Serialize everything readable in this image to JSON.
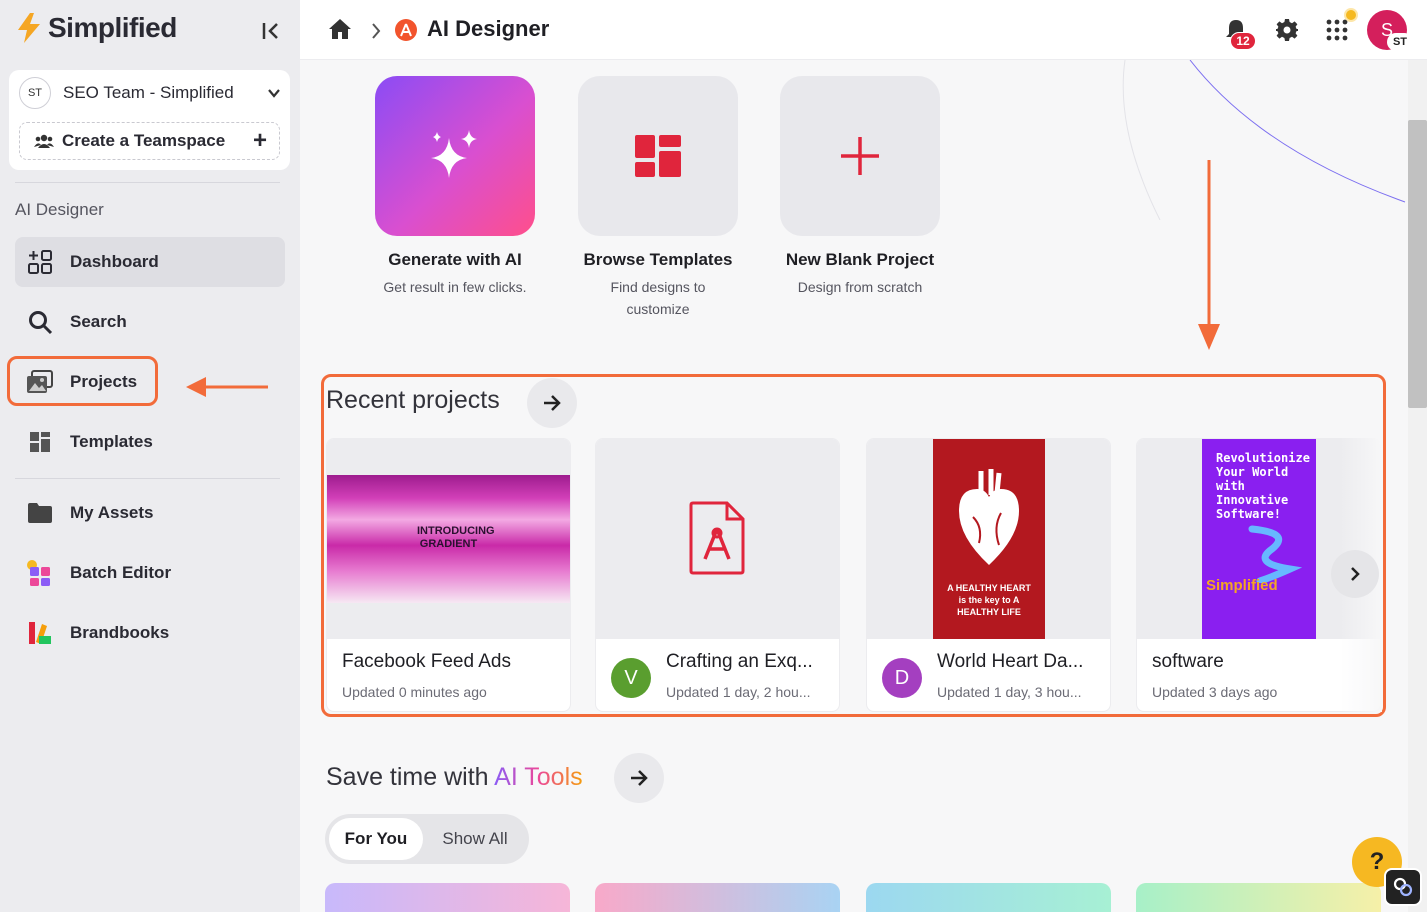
{
  "brand": {
    "name": "Simplified",
    "accent": "#f5a623"
  },
  "team": {
    "avatar": "ST",
    "name": "SEO Team - Simplified",
    "create_label": "Create a Teamspace"
  },
  "sidebar": {
    "section": "AI Designer",
    "items": [
      {
        "label": "Dashboard",
        "icon": "dashboard-icon",
        "active": true
      },
      {
        "label": "Search",
        "icon": "search-icon"
      },
      {
        "label": "Projects",
        "icon": "projects-icon"
      },
      {
        "label": "Templates",
        "icon": "templates-icon"
      },
      {
        "label": "My Assets",
        "icon": "folder-icon"
      },
      {
        "label": "Batch Editor",
        "icon": "batch-editor-icon"
      },
      {
        "label": "Brandbooks",
        "icon": "brandbook-icon"
      }
    ]
  },
  "header": {
    "title": "AI Designer",
    "notifications": "12",
    "avatar": "S",
    "avatar_sub": "ST"
  },
  "quick_actions": [
    {
      "title": "Generate with AI",
      "sub": "Get result in few clicks."
    },
    {
      "title": "Browse Templates",
      "sub": "Find designs to customize"
    },
    {
      "title": "New Blank Project",
      "sub": "Design from scratch"
    }
  ],
  "recent": {
    "title": "Recent projects",
    "projects": [
      {
        "name": "Facebook Feed Ads",
        "meta": "Updated 0 minutes ago",
        "thumb_text": "INTRODUCING GRADIENT"
      },
      {
        "name": "Crafting an Exq...",
        "meta": "Updated 1 day, 2 hou...",
        "avatar": "V",
        "avatar_color": "#5a9e2f"
      },
      {
        "name": "World Heart Da...",
        "meta": "Updated 1 day, 3 hou...",
        "avatar": "D",
        "avatar_color": "#a43fc0",
        "thumb_text": "A HEALTHY HEART is the key to A HEALTHY LIFE"
      },
      {
        "name": "software",
        "meta": "Updated 3 days ago",
        "thumb_text": "Revolutionize Your World with Innovative Software!",
        "thumb_brand": "Simplified"
      }
    ]
  },
  "ai_tools": {
    "title_prefix": "Save time with",
    "title_highlight": "AI Tools",
    "tabs": [
      "For You",
      "Show All"
    ]
  },
  "help_label": "?"
}
